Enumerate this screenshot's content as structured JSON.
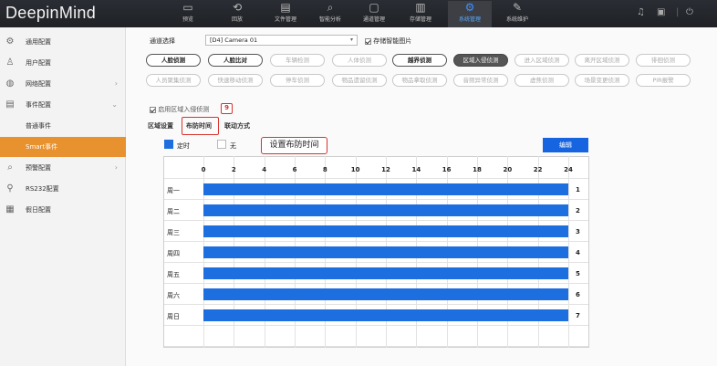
{
  "app": {
    "logo": "DeepinMind"
  },
  "topnav": [
    {
      "label": "预览",
      "icon": "preview-icon"
    },
    {
      "label": "回放",
      "icon": "playback-icon"
    },
    {
      "label": "文件管理",
      "icon": "folder-icon"
    },
    {
      "label": "智能分析",
      "icon": "search-analysis-icon"
    },
    {
      "label": "通道管理",
      "icon": "channel-icon"
    },
    {
      "label": "存储管理",
      "icon": "storage-icon"
    },
    {
      "label": "系统管理",
      "icon": "gear-icon"
    },
    {
      "label": "系统维护",
      "icon": "wrench-icon"
    }
  ],
  "sidebar": [
    {
      "label": "通用配置",
      "icon": "gear-icon"
    },
    {
      "label": "用户配置",
      "icon": "user-icon"
    },
    {
      "label": "网络配置",
      "icon": "globe-icon"
    },
    {
      "label": "事件配置",
      "icon": "event-icon"
    },
    {
      "label": "普通事件",
      "icon": ""
    },
    {
      "label": "Smart事件",
      "icon": ""
    },
    {
      "label": "预警配置",
      "icon": "alarm-icon"
    },
    {
      "label": "RS232配置",
      "icon": "rs232-icon"
    },
    {
      "label": "假日配置",
      "icon": "calendar-icon"
    }
  ],
  "channel": {
    "label": "通道选择",
    "value": "[D4] Camera 01",
    "store_label": "存储智能图片"
  },
  "detections_row1": [
    "人脸侦测",
    "人脸比对",
    "车辆检测",
    "人体侦测",
    "越界侦测",
    "区域入侵侦测",
    "进入区域侦测",
    "离开区域侦测",
    "徘徊侦测"
  ],
  "detections_row2": [
    "人员聚集侦测",
    "快速移动侦测",
    "停车侦测",
    "物品遗留侦测",
    "物品拿取侦测",
    "音频异常侦测",
    "虚焦侦测",
    "场景变更侦测",
    "PIR报警"
  ],
  "enable_label": "启用区域入侵侦测",
  "step_badge": "9",
  "tabs": [
    "区域设置",
    "布防时间",
    "联动方式"
  ],
  "legend": {
    "on": "定时",
    "off": "无"
  },
  "callout": "设置布防时间",
  "edit_button": "编辑",
  "hours": [
    "0",
    "2",
    "4",
    "6",
    "8",
    "10",
    "12",
    "14",
    "16",
    "18",
    "20",
    "22",
    "24"
  ],
  "schedule": {
    "days": [
      "周一",
      "周二",
      "周三",
      "周四",
      "周五",
      "周六",
      "周日"
    ],
    "numbers": [
      "1",
      "2",
      "3",
      "4",
      "5",
      "6",
      "7"
    ],
    "armed_hours": [
      [
        0,
        24
      ],
      [
        0,
        24
      ],
      [
        0,
        24
      ],
      [
        0,
        24
      ],
      [
        0,
        24
      ],
      [
        0,
        24
      ],
      [
        0,
        24
      ]
    ]
  },
  "colors": {
    "armed": "#1d6fe0",
    "accent": "#e8912f",
    "highlight": "#d9322c"
  }
}
